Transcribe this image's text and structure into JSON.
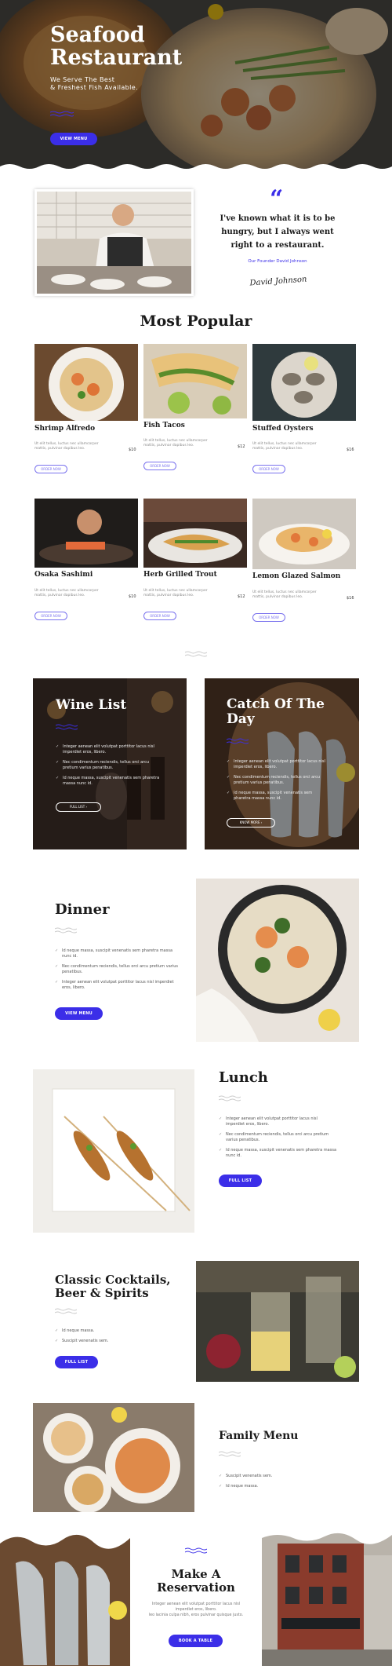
{
  "hero": {
    "title_line1": "Seafood",
    "title_line2": "Restaurant",
    "subtitle_line1": "We Serve The Best",
    "subtitle_line2": "& Freshest Fish Available.",
    "button": "VIEW MENU"
  },
  "quote": {
    "mark": "“",
    "text": "I've known what it is to be hungry, but I always went right to a restaurant.",
    "author": "Our Founder David Johnson",
    "signature": "David Johnson"
  },
  "popular": {
    "heading": "Most Popular",
    "items": [
      {
        "name": "Shrimp Alfredo",
        "desc": "Ut elit tellus, luctus nec ullamcorper mattis, pulvinar dapibus leo.",
        "price": "$10",
        "button": "ORDER NOW"
      },
      {
        "name": "Fish Tacos",
        "desc": "Ut elit tellus, luctus nec ullamcorper mattis, pulvinar dapibus leo.",
        "price": "$12",
        "button": "ORDER NOW"
      },
      {
        "name": "Stuffed Oysters",
        "desc": "Ut elit tellus, luctus nec ullamcorper mattis, pulvinar dapibus leo.",
        "price": "$16",
        "button": "ORDER NOW"
      },
      {
        "name": "Osaka Sashimi",
        "desc": "Ut elit tellus, luctus nec ullamcorper mattis, pulvinar dapibus leo.",
        "price": "$10",
        "button": "ORDER NOW"
      },
      {
        "name": "Herb Grilled Trout",
        "desc": "Ut elit tellus, luctus nec ullamcorper mattis, pulvinar dapibus leo.",
        "price": "$12",
        "button": "ORDER NOW"
      },
      {
        "name": "Lemon Glazed Salmon",
        "desc": "Ut elit tellus, luctus nec ullamcorper mattis, pulvinar dapibus leo.",
        "price": "$16",
        "button": "ORDER NOW"
      }
    ]
  },
  "wine": {
    "title": "Wine List",
    "items": [
      "Integer aenean elit volutpat porttitor lacus nisl imperdiet eros, libero.",
      "Nec condimentum reciendis, tellus orci arcu pretium varius penatibus.",
      "Id neque massa, suscipit venenatis sem pharetra massa nunc id."
    ],
    "button": "FULL LIST"
  },
  "catch": {
    "title_line1": "Catch Of The",
    "title_line2": "Day",
    "items": [
      "Integer aenean elit volutpat porttitor lacus nisl imperdiet eros, libero.",
      "Nec condimentum reciendis, tellus orci arcu pretium varius penatibus.",
      "Id neque massa, suscipit venenatis sem pharetra massa nunc id."
    ],
    "button": "KNOW MORE"
  },
  "dinner": {
    "title": "Dinner",
    "items": [
      "Id neque massa, suscipit venenatis sem pharetra massa nunc id.",
      "Nec condimentum reciendis, tellus orci arcu pretium varius penatibus.",
      "Integer aenean elit volutpat porttitor lacus nisl imperdiet eros, libero."
    ],
    "button": "VIEW MENU"
  },
  "lunch": {
    "title": "Lunch",
    "items": [
      "Integer aenean elit volutpat porttitor lacus nisl imperdiet eros, libero.",
      "Nec condimentum reciendis, tellus orci arcu pretium varius penatibus.",
      "Id neque massa, suscipit venenatis sem pharetra massa nunc id."
    ],
    "button": "FULL LIST"
  },
  "cocktails": {
    "title_line1": "Classic Cocktails,",
    "title_line2": "Beer & Spirits",
    "items": [
      "Id neque massa.",
      "Suscipit venenatis sem."
    ],
    "button": "FULL LIST"
  },
  "family": {
    "title": "Family Menu",
    "items": [
      "Suscipit venenatis sem.",
      "Id neque massa."
    ]
  },
  "reservation": {
    "title_line1": "Make A",
    "title_line2": "Reservation",
    "text_line1": "Integer aenean elit volutpat porttitor lacus nisl",
    "text_line2": "imperdiet eros, libero.",
    "text_line3": "leo lacinia culpa nibh, eros pulvinar quisque justo.",
    "button": "BOOK A TABLE"
  },
  "colors": {
    "accent": "#3b2ee8",
    "dark": "#1b1b1b"
  }
}
